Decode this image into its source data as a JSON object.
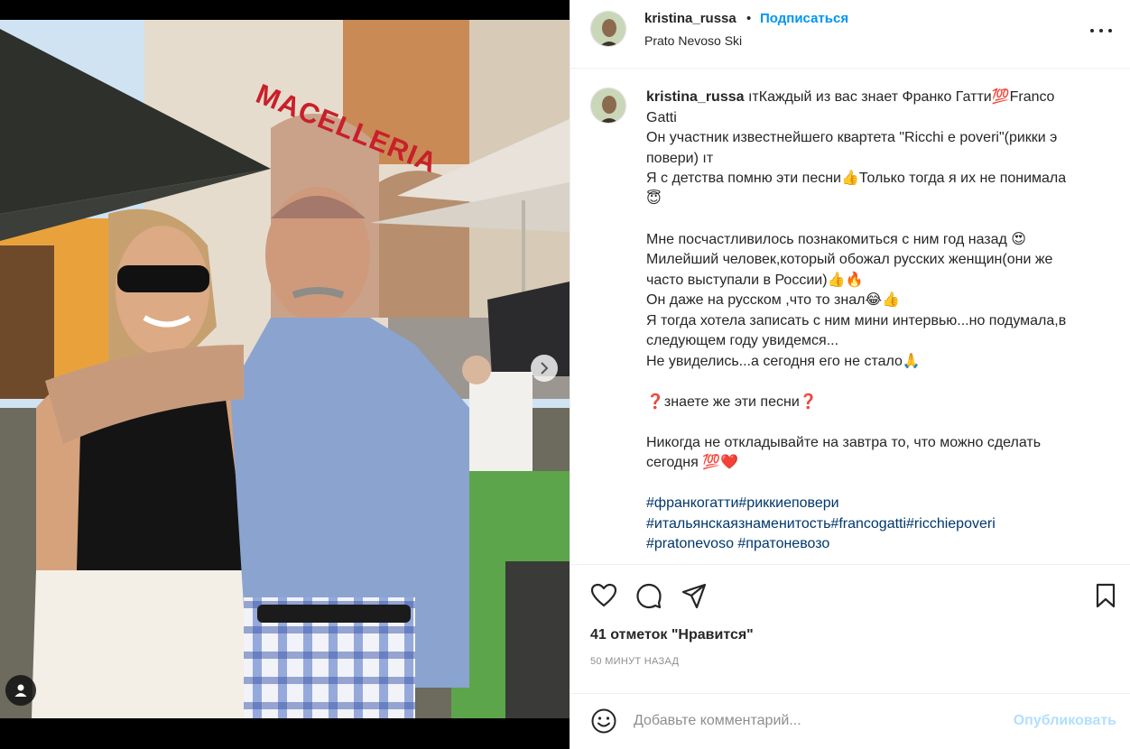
{
  "post": {
    "username": "kristina_russa",
    "follow_label": "Подписаться",
    "dot": "•",
    "location": "Prato Nevoso Ski"
  },
  "media": {
    "sign_text": "MACELLERIA",
    "next_icon": "chevron-right-icon",
    "tags_icon": "user-tag-icon"
  },
  "caption": {
    "username": "kristina_russa",
    "lines": [
      "ıтКаждый из вас знает Франко Гатти💯Franco",
      "Gatti",
      "Он участник известнейшего квартета \"Ricchi e poveri\"(рикки э",
      "повери) ıт",
      "Я с детства помню эти песни👍Только тогда я их не понимала",
      "😇",
      "",
      "Мне посчастливилось познакомиться с ним год назад 😍",
      "Милейший человек,который обожал русских женщин(они же",
      "часто выступали в России)👍🔥",
      "Он даже на русском ,что то знал😂👍",
      "Я тогда хотела записать с ним мини интервью...но подумала,в",
      "следующем году увидемся...",
      "Не увиделись...а сегодня его не стало🙏",
      "",
      "❓знаете же эти песни❓",
      "",
      "Никогда не откладывайте на завтра то, что можно сделать",
      "сегодня 💯❤️",
      ""
    ],
    "hashtags": [
      "#франкогатти#риккиеповери",
      "#итальянскаязнаменитость#francogatti#ricchiepoveri",
      "#pratonevoso #пратоневозо"
    ]
  },
  "actions": {
    "like_icon": "heart-icon",
    "comment_icon": "comment-icon",
    "share_icon": "paper-plane-icon",
    "save_icon": "bookmark-icon",
    "likes_text": "41 отметок \"Нравится\"",
    "time_text": "50 МИНУТ НАЗАД"
  },
  "comment": {
    "placeholder": "Добавьте комментарий...",
    "publish_label": "Опубликовать",
    "emoji_icon": "smiley-icon"
  },
  "colors": {
    "link_blue": "#0095f6",
    "hashtag": "#00376b",
    "publish_disabled": "#b2dffc",
    "text": "#262626",
    "muted": "#8e8e8e"
  }
}
